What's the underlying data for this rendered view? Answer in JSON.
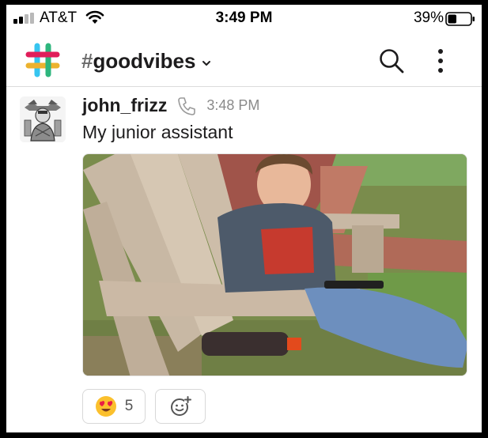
{
  "status_bar": {
    "carrier": "AT&T",
    "time": "3:49 PM",
    "battery_percent": "39%",
    "battery_level": 0.39,
    "signal_bars": 2,
    "icons": [
      "signal-icon",
      "wifi-icon",
      "battery-icon"
    ]
  },
  "header": {
    "channel_hash": "#",
    "channel_name": "goodvibes",
    "icons": [
      "slack-logo",
      "chevron-down-icon",
      "search-icon",
      "more-vertical-icon"
    ]
  },
  "message": {
    "username": "john_frizz",
    "timestamp": "3:48 PM",
    "text": "My junior assistant",
    "icons": [
      "avatar",
      "phone-icon"
    ],
    "attachment": "photo"
  },
  "reactions": [
    {
      "emoji": "heart-eyes-emoji",
      "count": "5"
    },
    {
      "emoji": "add-reaction-icon"
    }
  ],
  "colors": {
    "text": "#1d1c1d",
    "muted": "#8a8a8a",
    "divider": "#dcdcdc",
    "slack_blue": "#36c5f0",
    "slack_green": "#2eb67d",
    "slack_yellow": "#ecb22e",
    "slack_red": "#e01e5a"
  }
}
